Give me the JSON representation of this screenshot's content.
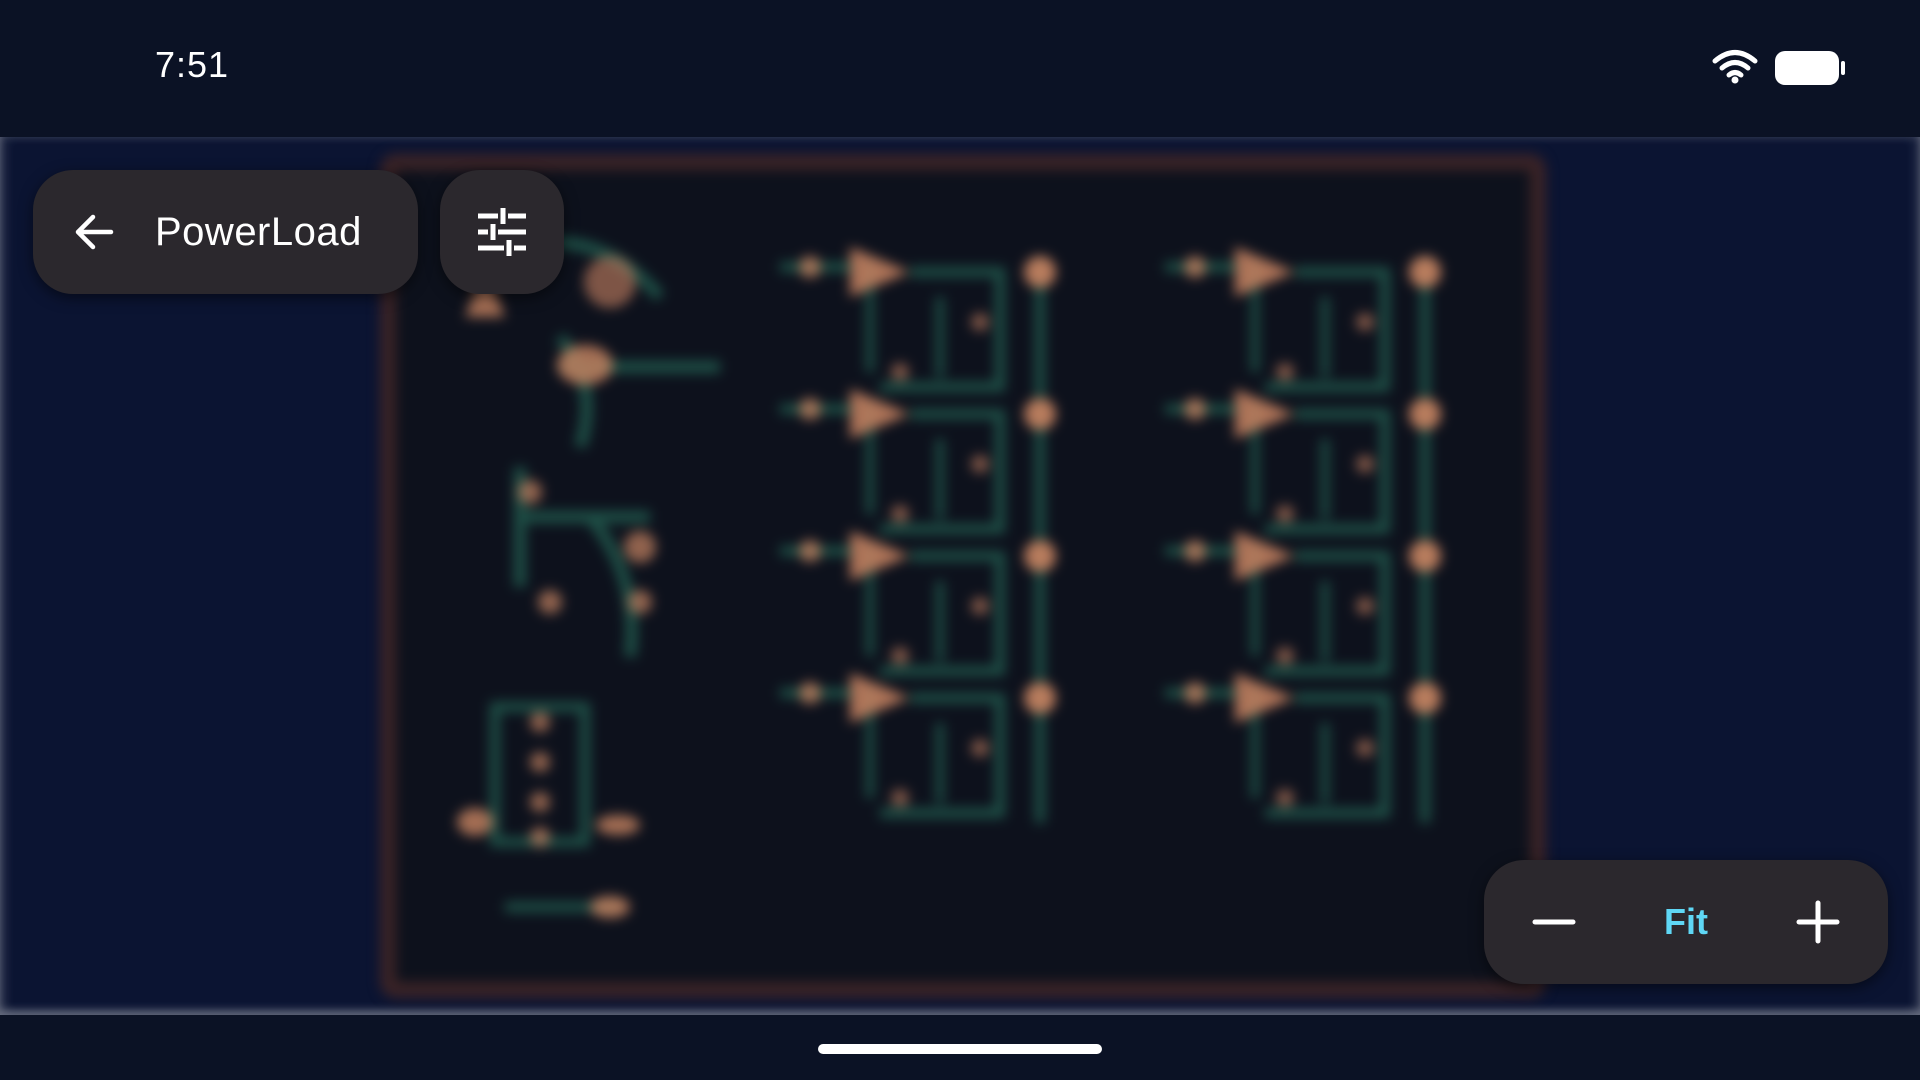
{
  "status_bar": {
    "time": "7:51",
    "icons": [
      "wifi-icon",
      "battery-icon"
    ]
  },
  "toolbar": {
    "back_icon": "arrow-left-icon",
    "title": "PowerLoad",
    "settings_icon": "tune-sliders-icon"
  },
  "zoom": {
    "out_icon": "minus-icon",
    "fit_label": "Fit",
    "in_icon": "plus-icon"
  },
  "colors": {
    "background": "#0b1225",
    "viewer_background": "#0b1432",
    "panel": "#2b282d",
    "accent": "#5fd7f5",
    "board_outline": "#3a2326",
    "trace": "#1e4f46",
    "pad": "#c98462"
  }
}
